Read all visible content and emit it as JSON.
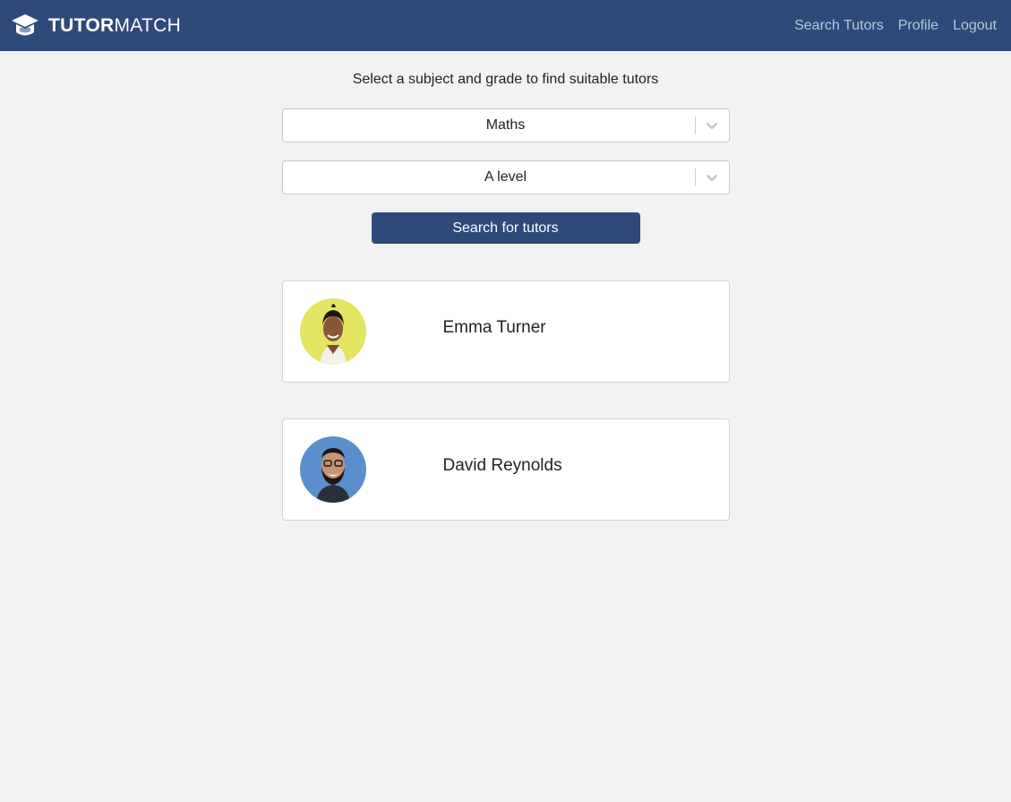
{
  "navbar": {
    "brand_bold": "TUTOR",
    "brand_light": "MATCH",
    "links": [
      "Search Tutors",
      "Profile",
      "Logout"
    ]
  },
  "main": {
    "prompt": "Select a subject and grade to find suitable tutors",
    "subject_select": {
      "value": "Maths"
    },
    "grade_select": {
      "value": "A level"
    },
    "search_button": "Search for tutors"
  },
  "tutors": [
    {
      "name": "Emma Turner",
      "avatar_bg": "#e3e563"
    },
    {
      "name": "David Reynolds",
      "avatar_bg": "#5b8fcc"
    }
  ],
  "colors": {
    "primary": "#2e4a7a",
    "background": "#f2f2f2",
    "nav_link": "#b9c6dc"
  },
  "icons": [
    "graduation-cap-icon",
    "chevron-down-icon"
  ]
}
